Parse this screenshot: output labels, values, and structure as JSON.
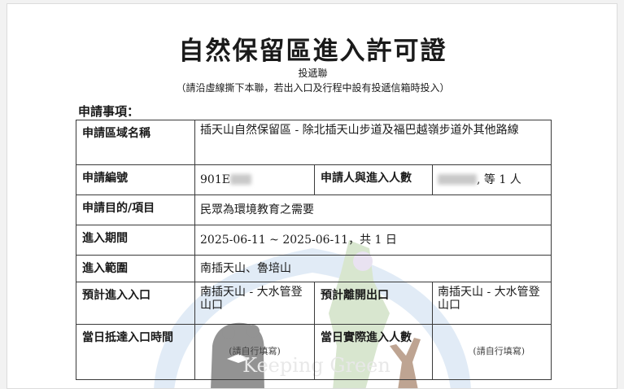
{
  "document": {
    "title": "自然保留區進入許可證",
    "subtitle": "投遞聯",
    "notice": "（請沿虛線撕下本聯，若出入口及行程中設有投遞信箱時投入）",
    "section_label": "申請事項："
  },
  "form": {
    "area": {
      "label": "申請區域名稱",
      "value": "插天山自然保留區 - 除北插天山步道及福巴越嶺步道外其他路線"
    },
    "app_no": {
      "label": "申請編號",
      "value": "901E"
    },
    "people": {
      "label": "申請人與進入人數",
      "value": ", 等 1 人"
    },
    "purpose": {
      "label": "申請目的/項目",
      "value": "民眾為環境教育之需要"
    },
    "period": {
      "label": "進入期間",
      "value": "2025-06-11 ~ 2025-06-11，共 1 日"
    },
    "scope": {
      "label": "進入範圍",
      "value": "南插天山、魯培山"
    },
    "entry": {
      "label": "預計進入入口",
      "value": "南插天山 - 大水管登山口"
    },
    "exit": {
      "label": "預計離開出口",
      "value": "南插天山 - 大水管登山口"
    },
    "arrival_time": {
      "label": "當日抵達入口時間",
      "hint": "(請自行填寫)"
    },
    "actual_count": {
      "label": "當日實際進入人數",
      "hint": "(請自行填寫)"
    }
  },
  "watermark": {
    "text": "Keeping Green"
  }
}
